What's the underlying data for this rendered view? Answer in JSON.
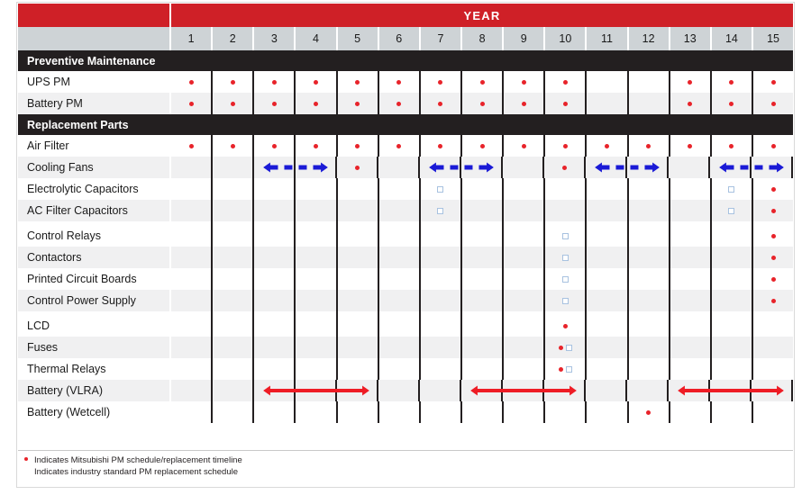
{
  "header": {
    "year_title": "YEAR",
    "years": [
      "1",
      "2",
      "3",
      "4",
      "5",
      "6",
      "7",
      "8",
      "9",
      "10",
      "11",
      "12",
      "13",
      "14",
      "15"
    ]
  },
  "colors": {
    "header_red": "#cf2027",
    "section_black": "#231f20",
    "year_band_gray": "#ced3d6",
    "dot_red": "#e8232a",
    "square_blue": "#a8c2e0",
    "arrow_blue": "#1a1ad6",
    "arrow_red": "#ee1c25"
  },
  "sections": [
    {
      "title": "Preventive Maintenance",
      "rows": [
        {
          "label": "UPS PM",
          "marks": [
            "dot",
            "dot",
            "dot",
            "dot",
            "dot",
            "dot",
            "dot",
            "dot",
            "dot",
            "dot",
            "",
            "",
            "dot",
            "dot",
            "dot"
          ],
          "arrows": []
        },
        {
          "label": "Battery PM",
          "marks": [
            "dot",
            "dot",
            "dot",
            "dot",
            "dot",
            "dot",
            "dot",
            "dot",
            "dot",
            "dot",
            "",
            "",
            "dot",
            "dot",
            "dot"
          ],
          "arrows": []
        }
      ]
    },
    {
      "title": "Replacement Parts",
      "rows": [
        {
          "label": "Air Filter",
          "marks": [
            "dot",
            "dot",
            "dot",
            "dot",
            "dot",
            "dot",
            "dot",
            "dot",
            "dot",
            "dot",
            "dot",
            "dot",
            "dot",
            "dot",
            "dot"
          ],
          "arrows": []
        },
        {
          "label": "Cooling Fans",
          "marks": [
            "",
            "",
            "",
            "",
            "dot",
            "",
            "",
            "",
            "",
            "dot",
            "",
            "",
            "",
            "",
            ""
          ],
          "arrows": [
            {
              "from": 3,
              "to": 4,
              "style": "dashed",
              "color": "#1a1ad6"
            },
            {
              "from": 7,
              "to": 8,
              "style": "dashed",
              "color": "#1a1ad6"
            },
            {
              "from": 11,
              "to": 12,
              "style": "dashed",
              "color": "#1a1ad6"
            },
            {
              "from": 14,
              "to": 15,
              "style": "dashed",
              "color": "#1a1ad6"
            }
          ]
        },
        {
          "label": "Electrolytic Capacitors",
          "marks": [
            "",
            "",
            "",
            "",
            "",
            "",
            "square",
            "",
            "",
            "",
            "",
            "",
            "",
            "square",
            "dot"
          ],
          "arrows": []
        },
        {
          "label": "AC Filter Capacitors",
          "marks": [
            "",
            "",
            "",
            "",
            "",
            "",
            "square",
            "",
            "",
            "",
            "",
            "",
            "",
            "square",
            "dot"
          ],
          "arrows": []
        },
        {
          "gap": true
        },
        {
          "label": "Control Relays",
          "marks": [
            "",
            "",
            "",
            "",
            "",
            "",
            "",
            "",
            "",
            "square",
            "",
            "",
            "",
            "",
            "dot"
          ],
          "arrows": []
        },
        {
          "label": "Contactors",
          "marks": [
            "",
            "",
            "",
            "",
            "",
            "",
            "",
            "",
            "",
            "square",
            "",
            "",
            "",
            "",
            "dot"
          ],
          "arrows": []
        },
        {
          "label": "Printed Circuit Boards",
          "marks": [
            "",
            "",
            "",
            "",
            "",
            "",
            "",
            "",
            "",
            "square",
            "",
            "",
            "",
            "",
            "dot"
          ],
          "arrows": []
        },
        {
          "label": "Control Power Supply",
          "marks": [
            "",
            "",
            "",
            "",
            "",
            "",
            "",
            "",
            "",
            "square",
            "",
            "",
            "",
            "",
            "dot"
          ],
          "arrows": []
        },
        {
          "gap": true
        },
        {
          "label": "LCD",
          "marks": [
            "",
            "",
            "",
            "",
            "",
            "",
            "",
            "",
            "",
            "dot",
            "",
            "",
            "",
            "",
            ""
          ],
          "arrows": []
        },
        {
          "label": "Fuses",
          "marks": [
            "",
            "",
            "",
            "",
            "",
            "",
            "",
            "",
            "",
            "dot-square",
            "",
            "",
            "",
            "",
            ""
          ],
          "arrows": []
        },
        {
          "label": "Thermal Relays",
          "marks": [
            "",
            "",
            "",
            "",
            "",
            "",
            "",
            "",
            "",
            "dot-square",
            "",
            "",
            "",
            "",
            ""
          ],
          "arrows": []
        },
        {
          "label": "Battery (VLRA)",
          "marks": [
            "",
            "",
            "",
            "",
            "",
            "",
            "",
            "",
            "",
            "",
            "",
            "",
            "",
            "",
            ""
          ],
          "arrows": [
            {
              "from": 3,
              "to": 5,
              "style": "solid",
              "color": "#ee1c25"
            },
            {
              "from": 8,
              "to": 10,
              "style": "solid",
              "color": "#ee1c25"
            },
            {
              "from": 13,
              "to": 15,
              "style": "solid",
              "color": "#ee1c25"
            }
          ]
        },
        {
          "label": "Battery (Wetcell)",
          "marks": [
            "",
            "",
            "",
            "",
            "",
            "",
            "",
            "",
            "",
            "",
            "",
            "dot",
            "",
            "",
            ""
          ],
          "arrows": []
        }
      ]
    }
  ],
  "legend": [
    {
      "marker": "dot",
      "text": "Indicates Mitsubishi PM schedule/replacement timeline"
    },
    {
      "marker": "square-white",
      "text": "Indicates industry standard PM replacement schedule"
    }
  ]
}
